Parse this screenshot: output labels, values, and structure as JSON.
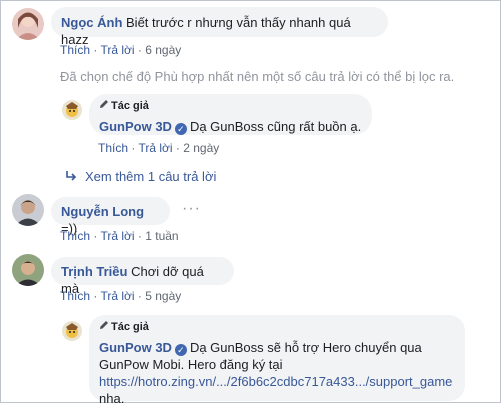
{
  "comments": [
    {
      "author": "Ngọc Ánh",
      "text": "Biết trước r nhưng vẫn thấy nhanh quá hazz",
      "like": "Thích",
      "reply": "Trả lời",
      "time": "6 ngày"
    },
    {
      "author": "Nguyễn Long",
      "text": "=))",
      "like": "Thích",
      "reply": "Trả lời",
      "time": "1 tuần"
    },
    {
      "author": "Trịnh Triều",
      "text": "Chơi dỡ quá mà",
      "like": "Thích",
      "reply": "Trả lời",
      "time": "5 ngày"
    }
  ],
  "filter_note": "Đã chọn chế độ Phù hợp nhất nên một số câu trả lời có thể bị lọc ra.",
  "replies": [
    {
      "author_tag": "Tác giả",
      "author": "GunPow 3D",
      "text": "Dạ GunBoss cũng rất buồn ạ.",
      "like": "Thích",
      "reply": "Trả lời",
      "time": "2 ngày"
    },
    {
      "author_tag": "Tác giả",
      "author": "GunPow 3D",
      "text_line1": "Dạ GunBoss sẽ hỗ trợ Hero chuyển qua",
      "text_line2": "GunPow Mobi. Hero đăng ký tại",
      "link": "https://hotro.zing.vn/.../2f6b6c2cdbc717a433.../support_game",
      "text_line3": "nha."
    }
  ],
  "more_replies": "Xem thêm 1 câu trả lời",
  "icons": {
    "pencil": "pencil-icon",
    "verified": "verified-icon",
    "reply_arrow": "reply-arrow-icon",
    "more": "more-options-icon"
  },
  "colors": {
    "link": "#385898",
    "bubble": "#f2f3f5",
    "meta": "#606770",
    "verified": "#4267b2"
  }
}
